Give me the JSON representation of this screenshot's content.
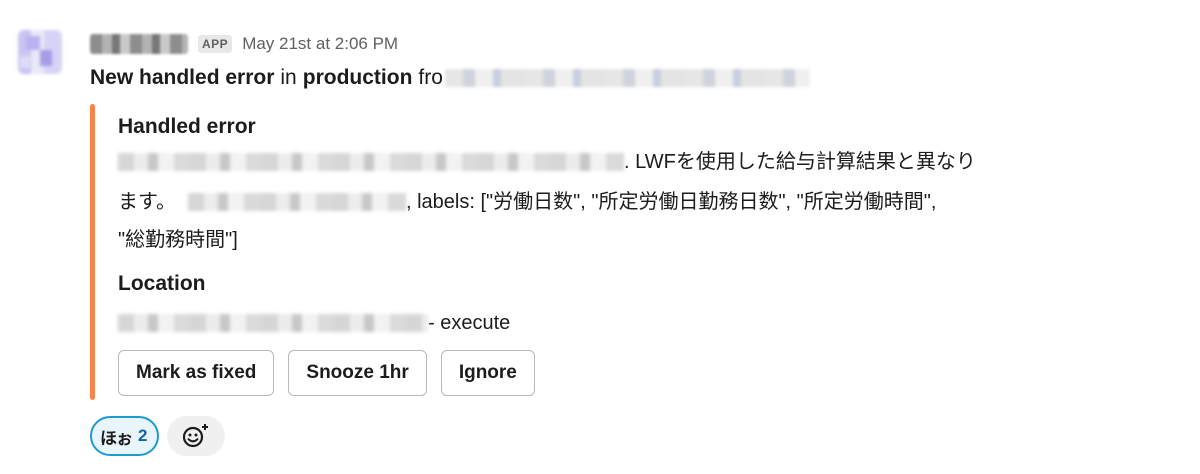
{
  "message": {
    "app_badge": "APP",
    "timestamp": "May 21st at 2:06 PM",
    "headline": {
      "part1": "New handled error",
      "part2": "in",
      "part3": "production",
      "part4": "fro"
    }
  },
  "attachment": {
    "accent_color": "#f5834a",
    "field1_title": "Handled error",
    "error_line1_suffix": ". LWFを使用した給与計算結果と異なり",
    "error_line2_prefix": "ます。",
    "error_line2_suffix": ", labels: [\"労働日数\", \"所定労働日勤務日数\", \"所定労働時間\",",
    "error_line3": "\"総勤務時間\"]",
    "field2_title": "Location",
    "location_suffix": " - execute",
    "buttons": {
      "mark_fixed": "Mark as fixed",
      "snooze": "Snooze 1hr",
      "ignore": "Ignore"
    }
  },
  "reactions": [
    {
      "emoji": "ほぉ",
      "count": "2"
    }
  ],
  "add_reaction_icon": "add-emoji-icon"
}
